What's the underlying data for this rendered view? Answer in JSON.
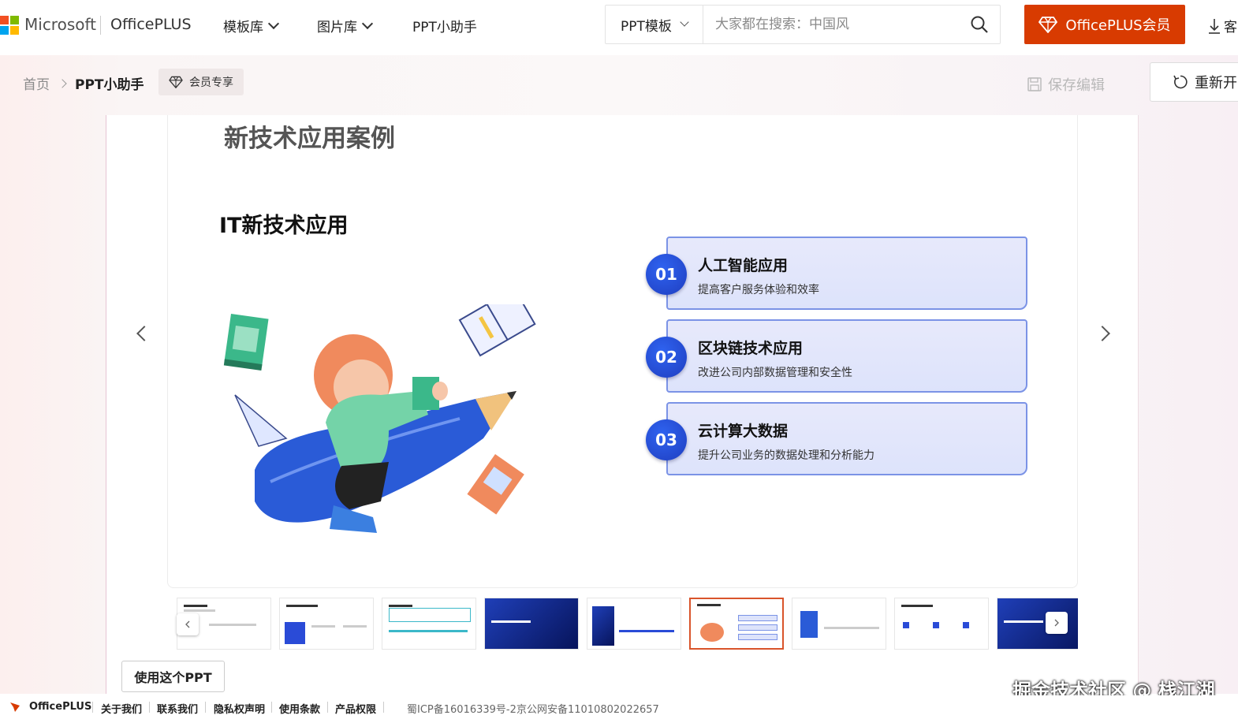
{
  "header": {
    "ms_text": "Microsoft",
    "brand": "OfficePLUS",
    "nav": [
      {
        "label": "模板库"
      },
      {
        "label": "图片库"
      },
      {
        "label": "PPT小助手"
      }
    ],
    "search": {
      "category": "PPT模板",
      "placeholder": "大家都在搜索：中国风"
    },
    "vip_label": "OfficePLUS会员",
    "download_label": "客"
  },
  "toolbar": {
    "breadcrumb_home": "首页",
    "breadcrumb_current": "PPT小助手",
    "vip_badge": "会员专享",
    "save_label": "保存编辑",
    "reopen_label": "重新开"
  },
  "slide": {
    "title": "新技术应用案例",
    "subtitle": "IT新技术应用",
    "items": [
      {
        "num": "01",
        "title": "人工智能应用",
        "desc": "提高客户服务体验和效率"
      },
      {
        "num": "02",
        "title": "区块链技术应用",
        "desc": "改进公司内部数据管理和安全性"
      },
      {
        "num": "03",
        "title": "云计算大数据",
        "desc": "提升公司业务的数据处理和分析能力"
      }
    ]
  },
  "actions": {
    "use_label": "使用这个PPT"
  },
  "watermark": "掘金技术社区 @ 栈江湖",
  "footer": {
    "brand": "OfficePLUS",
    "links": [
      "关于我们",
      "联系我们",
      "隐私权声明",
      "使用条款",
      "产品权限"
    ],
    "icp": "蜀ICP备16016339号-2",
    "security": "京公网安备11010802022657"
  },
  "colors": {
    "accent": "#d83b01",
    "card_border": "#7b93e6",
    "num_circle": "#2f63f0"
  }
}
